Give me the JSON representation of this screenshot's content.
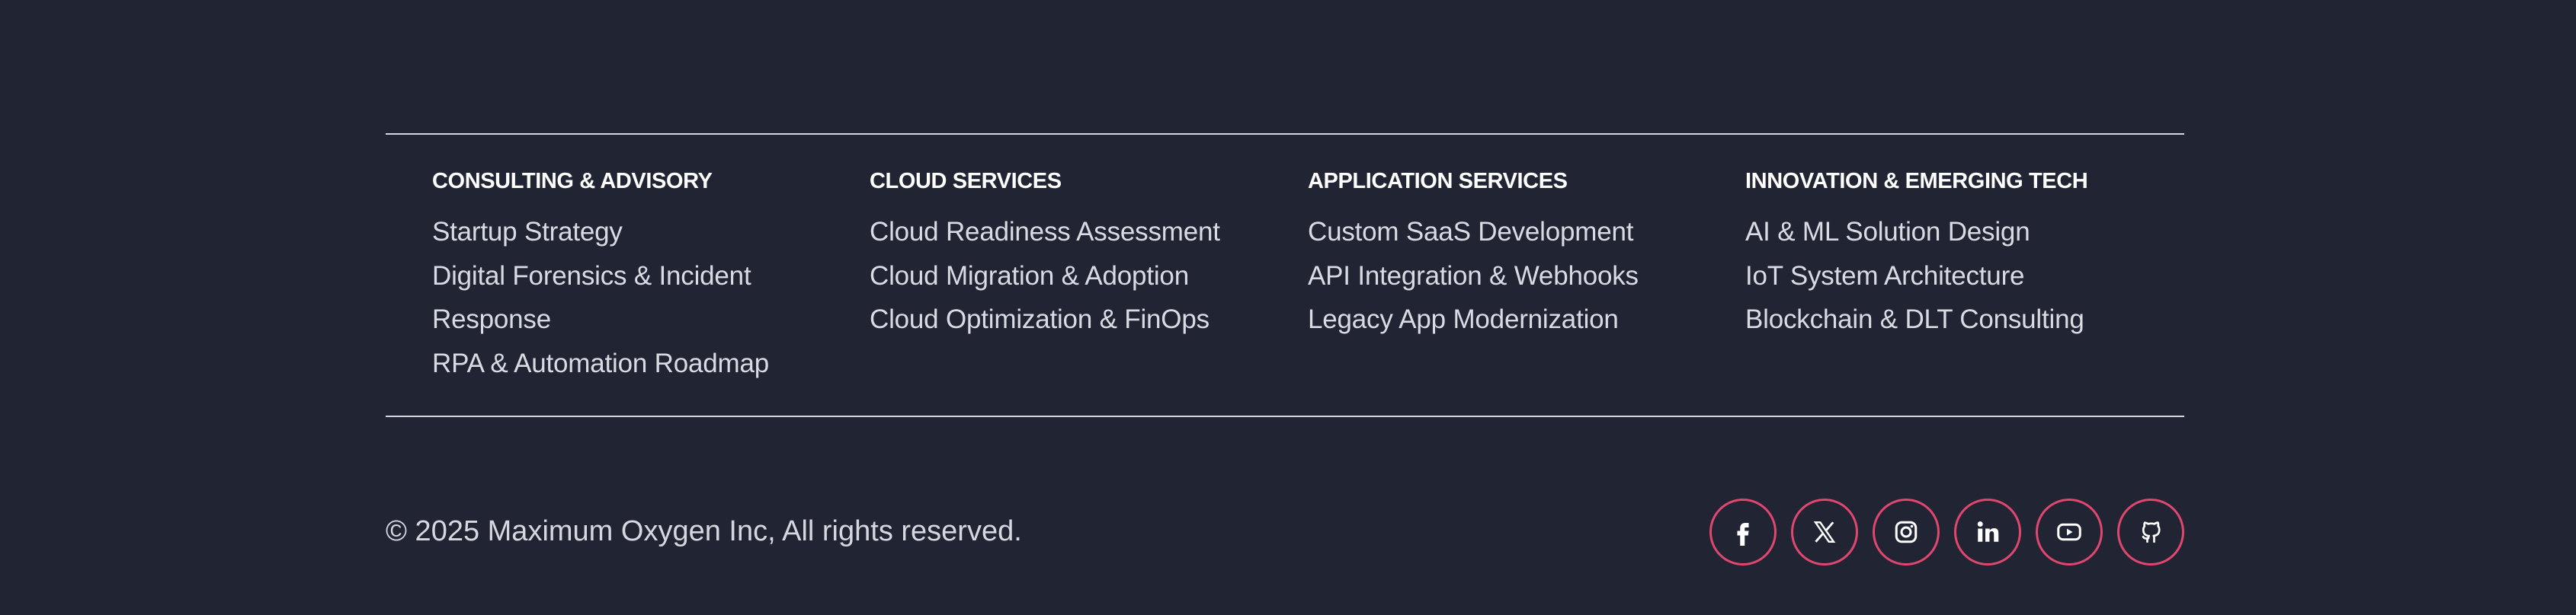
{
  "footer": {
    "columns": [
      {
        "title": "CONSULTING & ADVISORY",
        "items": [
          "Startup Strategy",
          "Digital Forensics & Incident Response",
          "RPA & Automation Roadmap"
        ]
      },
      {
        "title": "CLOUD SERVICES",
        "items": [
          "Cloud Readiness Assessment",
          "Cloud Migration & Adoption",
          "Cloud Optimization & FinOps"
        ]
      },
      {
        "title": "APPLICATION SERVICES",
        "items": [
          "Custom SaaS Development",
          "API Integration & Webhooks",
          "Legacy App Modernization"
        ]
      },
      {
        "title": "INNOVATION & EMERGING TECH",
        "items": [
          "AI & ML Solution Design",
          "IoT System Architecture",
          "Blockchain & DLT Consulting"
        ]
      }
    ],
    "copyright": "© 2025 Maximum Oxygen Inc, All rights reserved.",
    "social_icons": [
      "facebook-icon",
      "x-twitter-icon",
      "instagram-icon",
      "linkedin-icon",
      "youtube-icon",
      "github-icon"
    ]
  },
  "colors": {
    "background": "#212433",
    "accent": "#e0476f",
    "text": "#d9dbe3",
    "divider": "#d5d7de"
  }
}
